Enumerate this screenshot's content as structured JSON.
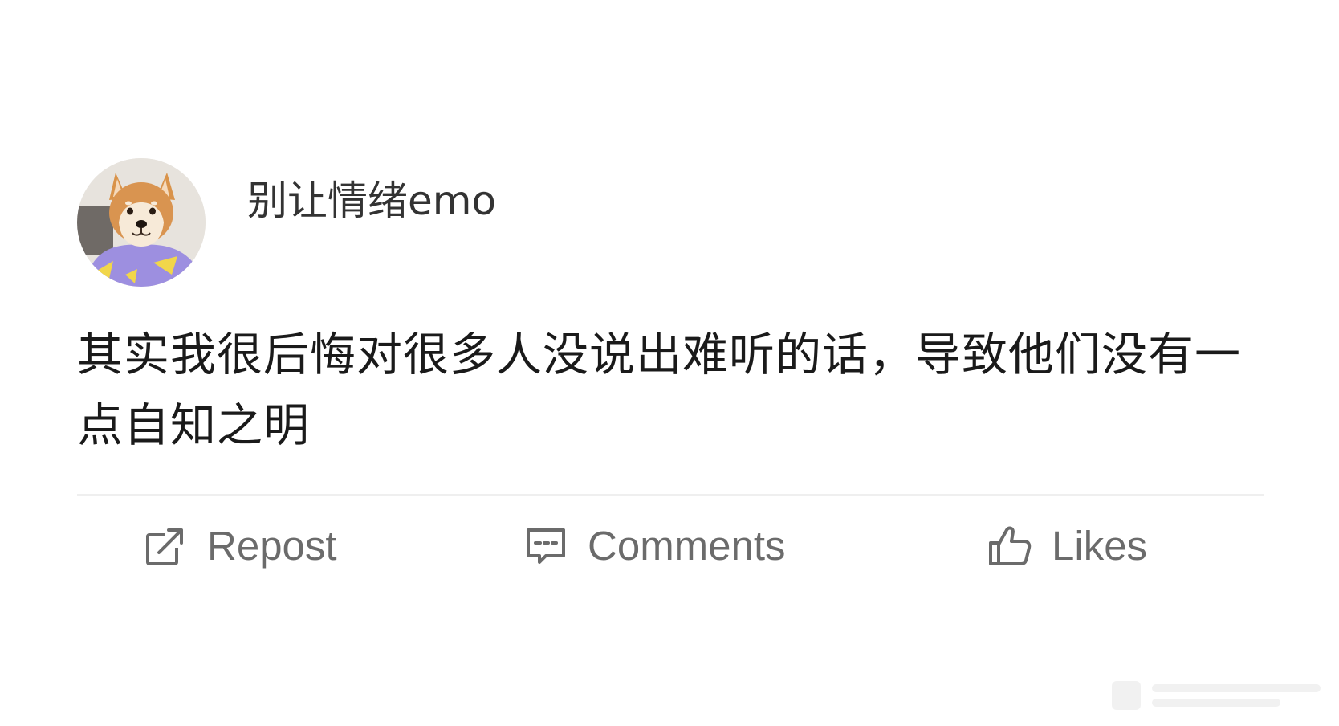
{
  "post": {
    "username": "别让情绪emo",
    "text": "其实我很后悔对很多人没说出难听的话，导致他们没有一点自知之明"
  },
  "actions": {
    "repost": {
      "label": "Repost",
      "icon": "repost-icon"
    },
    "comments": {
      "label": "Comments",
      "icon": "comment-icon"
    },
    "likes": {
      "label": "Likes",
      "icon": "thumbs-up-icon"
    }
  },
  "colors": {
    "text_primary": "#1a1a1a",
    "username": "#333333",
    "action_gray": "#6b6b6b",
    "divider": "#efefef",
    "background": "#ffffff"
  }
}
